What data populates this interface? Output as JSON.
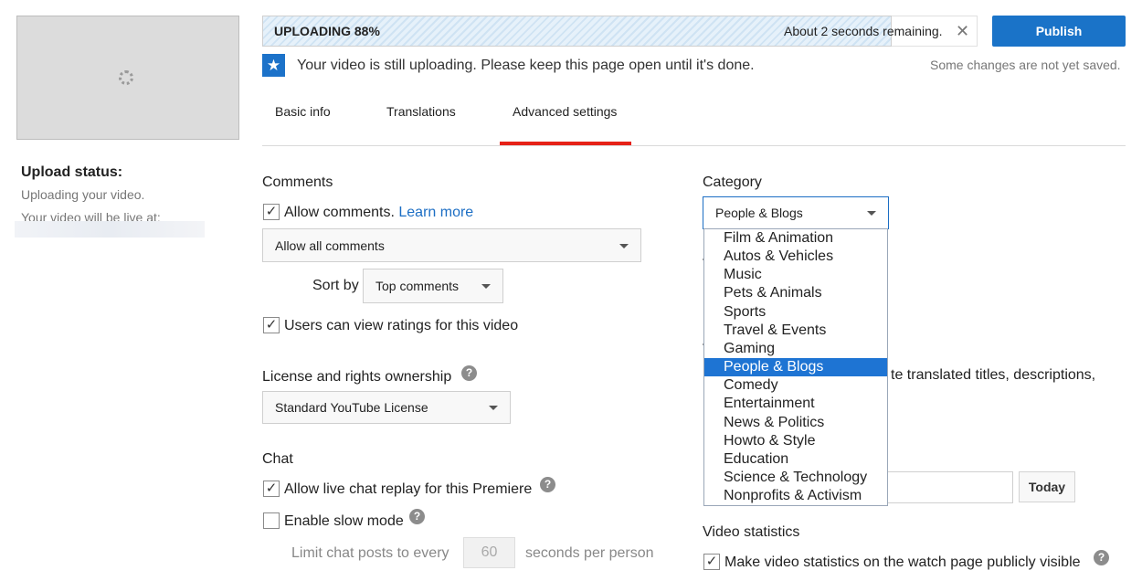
{
  "sidebar": {
    "upload_status_title": "Upload status:",
    "uploading_text": "Uploading your video.",
    "live_at_text": "Your video will be live at:"
  },
  "upload": {
    "progress_label": "UPLOADING 88%",
    "progress_percent": 88,
    "remaining": "About 2 seconds remaining.",
    "close_glyph": "✕",
    "publish_label": "Publish",
    "notice": "Your video is still uploading. Please keep this page open until it's done.",
    "notice_icon": "star-icon",
    "unsaved": "Some changes are not yet saved."
  },
  "tabs": [
    {
      "label": "Basic info",
      "active": false
    },
    {
      "label": "Translations",
      "active": false
    },
    {
      "label": "Advanced settings",
      "active": true
    }
  ],
  "comments": {
    "title": "Comments",
    "allow_label": "Allow comments.",
    "learn_more": "Learn more",
    "allow_checked": true,
    "filter_value": "Allow all comments",
    "sort_label": "Sort by",
    "sort_value": "Top comments",
    "ratings_label": "Users can view ratings for this video",
    "ratings_checked": true
  },
  "license": {
    "title": "License and rights ownership",
    "value": "Standard YouTube License"
  },
  "chat": {
    "title": "Chat",
    "replay_label": "Allow live chat replay for this Premiere",
    "replay_checked": true,
    "slow_label": "Enable slow mode",
    "slow_checked": false,
    "limit_prefix": "Limit chat posts to every",
    "limit_value": "60",
    "limit_suffix": "seconds per person"
  },
  "category": {
    "title": "Category",
    "selected": "People & Blogs",
    "options": [
      "Film & Animation",
      "Autos & Vehicles",
      "Music",
      "Pets & Animals",
      "Sports",
      "Travel & Events",
      "Gaming",
      "People & Blogs",
      "Comedy",
      "Entertainment",
      "News & Politics",
      "Howto & Style",
      "Education",
      "Science & Technology",
      "Nonprofits & Activism"
    ],
    "highlighted_index": 7
  },
  "translations_partial": "te translated titles, descriptions,",
  "recording": {
    "today_label": "Today"
  },
  "video_statistics": {
    "title": "Video statistics",
    "label": "Make video statistics on the watch page publicly visible",
    "checked": true
  },
  "colors": {
    "accent_blue": "#1a73c8",
    "tab_indicator_red": "#e62117",
    "menu_highlight": "#1e74d3"
  }
}
